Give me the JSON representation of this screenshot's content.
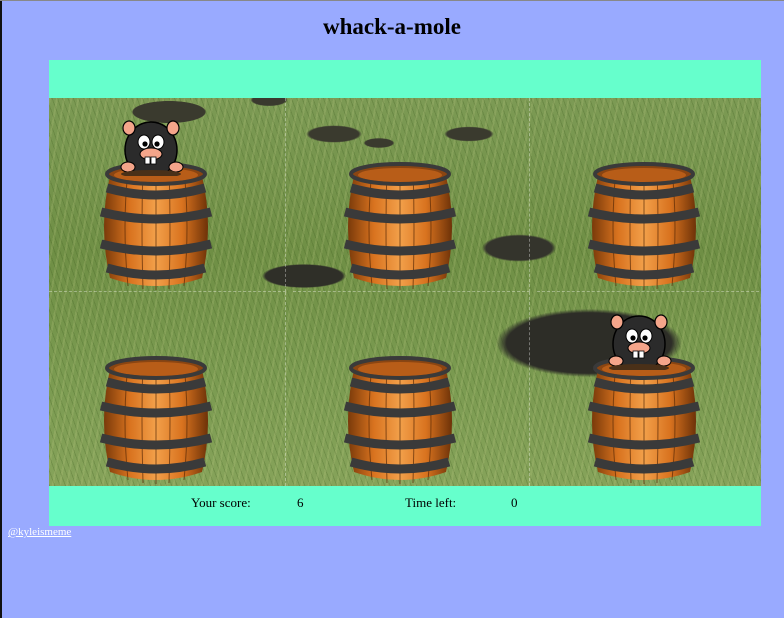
{
  "page": {
    "title": "whack-a-mole"
  },
  "board": {
    "holes": [
      {
        "id": 1,
        "mole_visible": true
      },
      {
        "id": 2,
        "mole_visible": false
      },
      {
        "id": 3,
        "mole_visible": false
      },
      {
        "id": 4,
        "mole_visible": false
      },
      {
        "id": 5,
        "mole_visible": false
      },
      {
        "id": 6,
        "mole_visible": true
      }
    ]
  },
  "status": {
    "score_label": "Your score:",
    "score_value": "6",
    "time_label": "Time left:",
    "time_value": "0"
  },
  "footer": {
    "credit_link": "@kyleismeme"
  },
  "colors": {
    "page_background": "#99aaff",
    "game_panel": "#66ffcc",
    "barrel_wood": "#d9731f",
    "barrel_band": "#3a3a3a",
    "mole_fur": "#2b2b2b"
  }
}
